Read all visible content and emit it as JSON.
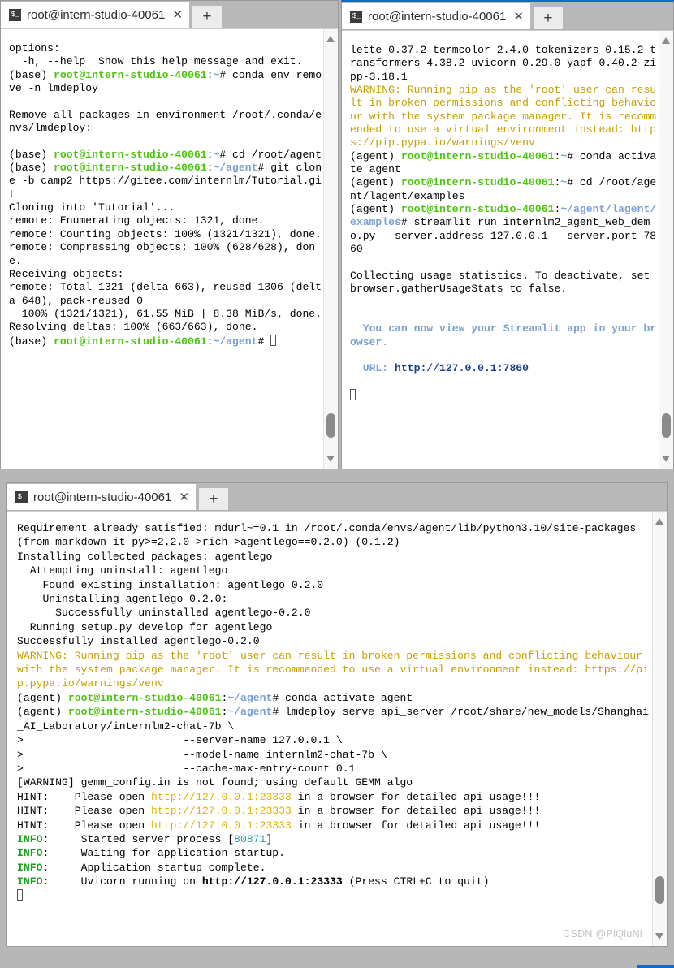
{
  "window_title": "root@intern-studio-40061",
  "tab": {
    "icon": "terminal-icon",
    "icon_glyph": "$_",
    "title": "root@intern-studio-40061",
    "close_label": "✕",
    "new_tab_label": "+"
  },
  "colors": {
    "accent_blue": "#1569c7",
    "prompt_green": "#4fc414",
    "path_blue": "#7b9fd4",
    "warning_yellow": "#c8a005",
    "hint_url_yellow": "#e0b400",
    "info_green": "#1ea01e",
    "streamlit_blue": "#7ba3d0",
    "tabbar_gray": "#b8b8b8",
    "page_bg": "#b7b7b7"
  },
  "scrollbar": {
    "up_arrow": "scroll-up-arrow",
    "down_arrow": "scroll-down-arrow",
    "thumb": "scroll-thumb"
  },
  "watermark": "CSDN @PiQiuNi",
  "terminals": [
    {
      "id": "terminal-1",
      "active": false,
      "lines": [
        "options:",
        "  -h, --help  Show this help message and exit.",
        "[P](base) [G]root@intern-studio-40061[/G]:[B]~[/B]# conda env remove -n lmdeploy",
        "",
        "Remove all packages in environment /root/.conda/envs/lmdeploy:",
        "",
        "[P](base) [G]root@intern-studio-40061[/G]:[B]~[/B]# cd /root/agent",
        "[P](base) [G]root@intern-studio-40061[/G]:[B]~/agent[/B]# git clone -b camp2 https://gitee.com/internlm/Tutorial.git",
        "Cloning into 'Tutorial'...",
        "remote: Enumerating objects: 1321, done.",
        "remote: Counting objects: 100% (1321/1321), done.",
        "remote: Compressing objects: 100% (628/628), done.",
        "Receiving objects:",
        "remote: Total 1321 (delta 663), reused 1306 (delta 648), pack-reused 0",
        "  100% (1321/1321), 61.55 MiB | 8.38 MiB/s, done.",
        "Resolving deltas: 100% (663/663), done.",
        "[P](base) [G]root@intern-studio-40061[/G]:[B]~/agent[/B]# [CURSOR]"
      ]
    },
    {
      "id": "terminal-2",
      "active": true,
      "lines": [
        "lette-0.37.2 termcolor-2.4.0 tokenizers-0.15.2 transformers-4.38.2 uvicorn-0.29.0 yapf-0.40.2 zipp-3.18.1",
        "[Y]WARNING: Running pip as the 'root' user can result in broken permissions and conflicting behaviour with the system package manager. It is recommended to use a virtual environment instead: https://pip.pypa.io/warnings/venv[/Y]",
        "[P](agent) [G]root@intern-studio-40061[/G]:[B]~[/B]# conda activate agent",
        "[P](agent) [G]root@intern-studio-40061[/G]:[B]~[/B]# cd /root/agent/lagent/examples",
        "[P](agent) [G]root@intern-studio-40061[/G]:[B]~/agent/lagent/examples[/B]# streamlit run internlm2_agent_web_demo.py --server.address 127.0.0.1 --server.port 7860",
        "",
        "Collecting usage statistics. To deactivate, set browser.gatherUsageStats to false.",
        "",
        "",
        "[S]  You can now view your Streamlit app in your browser.[/S]",
        "",
        "[S]  URL: [/S][N]http://127.0.0.1:7860[/N]",
        "",
        "[CURSOR]"
      ]
    },
    {
      "id": "terminal-3",
      "active": false,
      "lines": [
        "Requirement already satisfied: mdurl~=0.1 in /root/.conda/envs/agent/lib/python3.10/site-packages (from markdown-it-py>=2.2.0->rich->agentlego==0.2.0) (0.1.2)",
        "Installing collected packages: agentlego",
        "  Attempting uninstall: agentlego",
        "    Found existing installation: agentlego 0.2.0",
        "    Uninstalling agentlego-0.2.0:",
        "      Successfully uninstalled agentlego-0.2.0",
        "  Running setup.py develop for agentlego",
        "Successfully installed agentlego-0.2.0",
        "[Y]WARNING: Running pip as the 'root' user can result in broken permissions and conflicting behaviour with the system package manager. It is recommended to use a virtual environment instead: https://pip.pypa.io/warnings/venv[/Y]",
        "[P](agent) [G]root@intern-studio-40061[/G]:[B]~/agent[/B]# conda activate agent",
        "[P](agent) [G]root@intern-studio-40061[/G]:[B]~/agent[/B]# lmdeploy serve api_server /root/share/new_models/Shanghai_AI_Laboratory/internlm2-chat-7b \\",
        ">                         --server-name 127.0.0.1 \\",
        ">                         --model-name internlm2-chat-7b \\",
        ">                         --cache-max-entry-count 0.1",
        "[WARNING] gemm_config.in is not found; using default GEMM algo",
        "HINT:    Please open [H]http://127.0.0.1:23333[/H] in a browser for detailed api usage!!!",
        "HINT:    Please open [H]http://127.0.0.1:23333[/H] in a browser for detailed api usage!!!",
        "HINT:    Please open [H]http://127.0.0.1:23333[/H] in a browser for detailed api usage!!!",
        "[I]INFO[/I]:     Started server process [[T]80871[/T]]",
        "[I]INFO[/I]:     Waiting for application startup.",
        "[I]INFO[/I]:     Application startup complete.",
        "[I]INFO[/I]:     Uvicorn running on [D]http://127.0.0.1:23333[/D] (Press CTRL+C to quit)",
        "[CURSOR]"
      ]
    }
  ]
}
